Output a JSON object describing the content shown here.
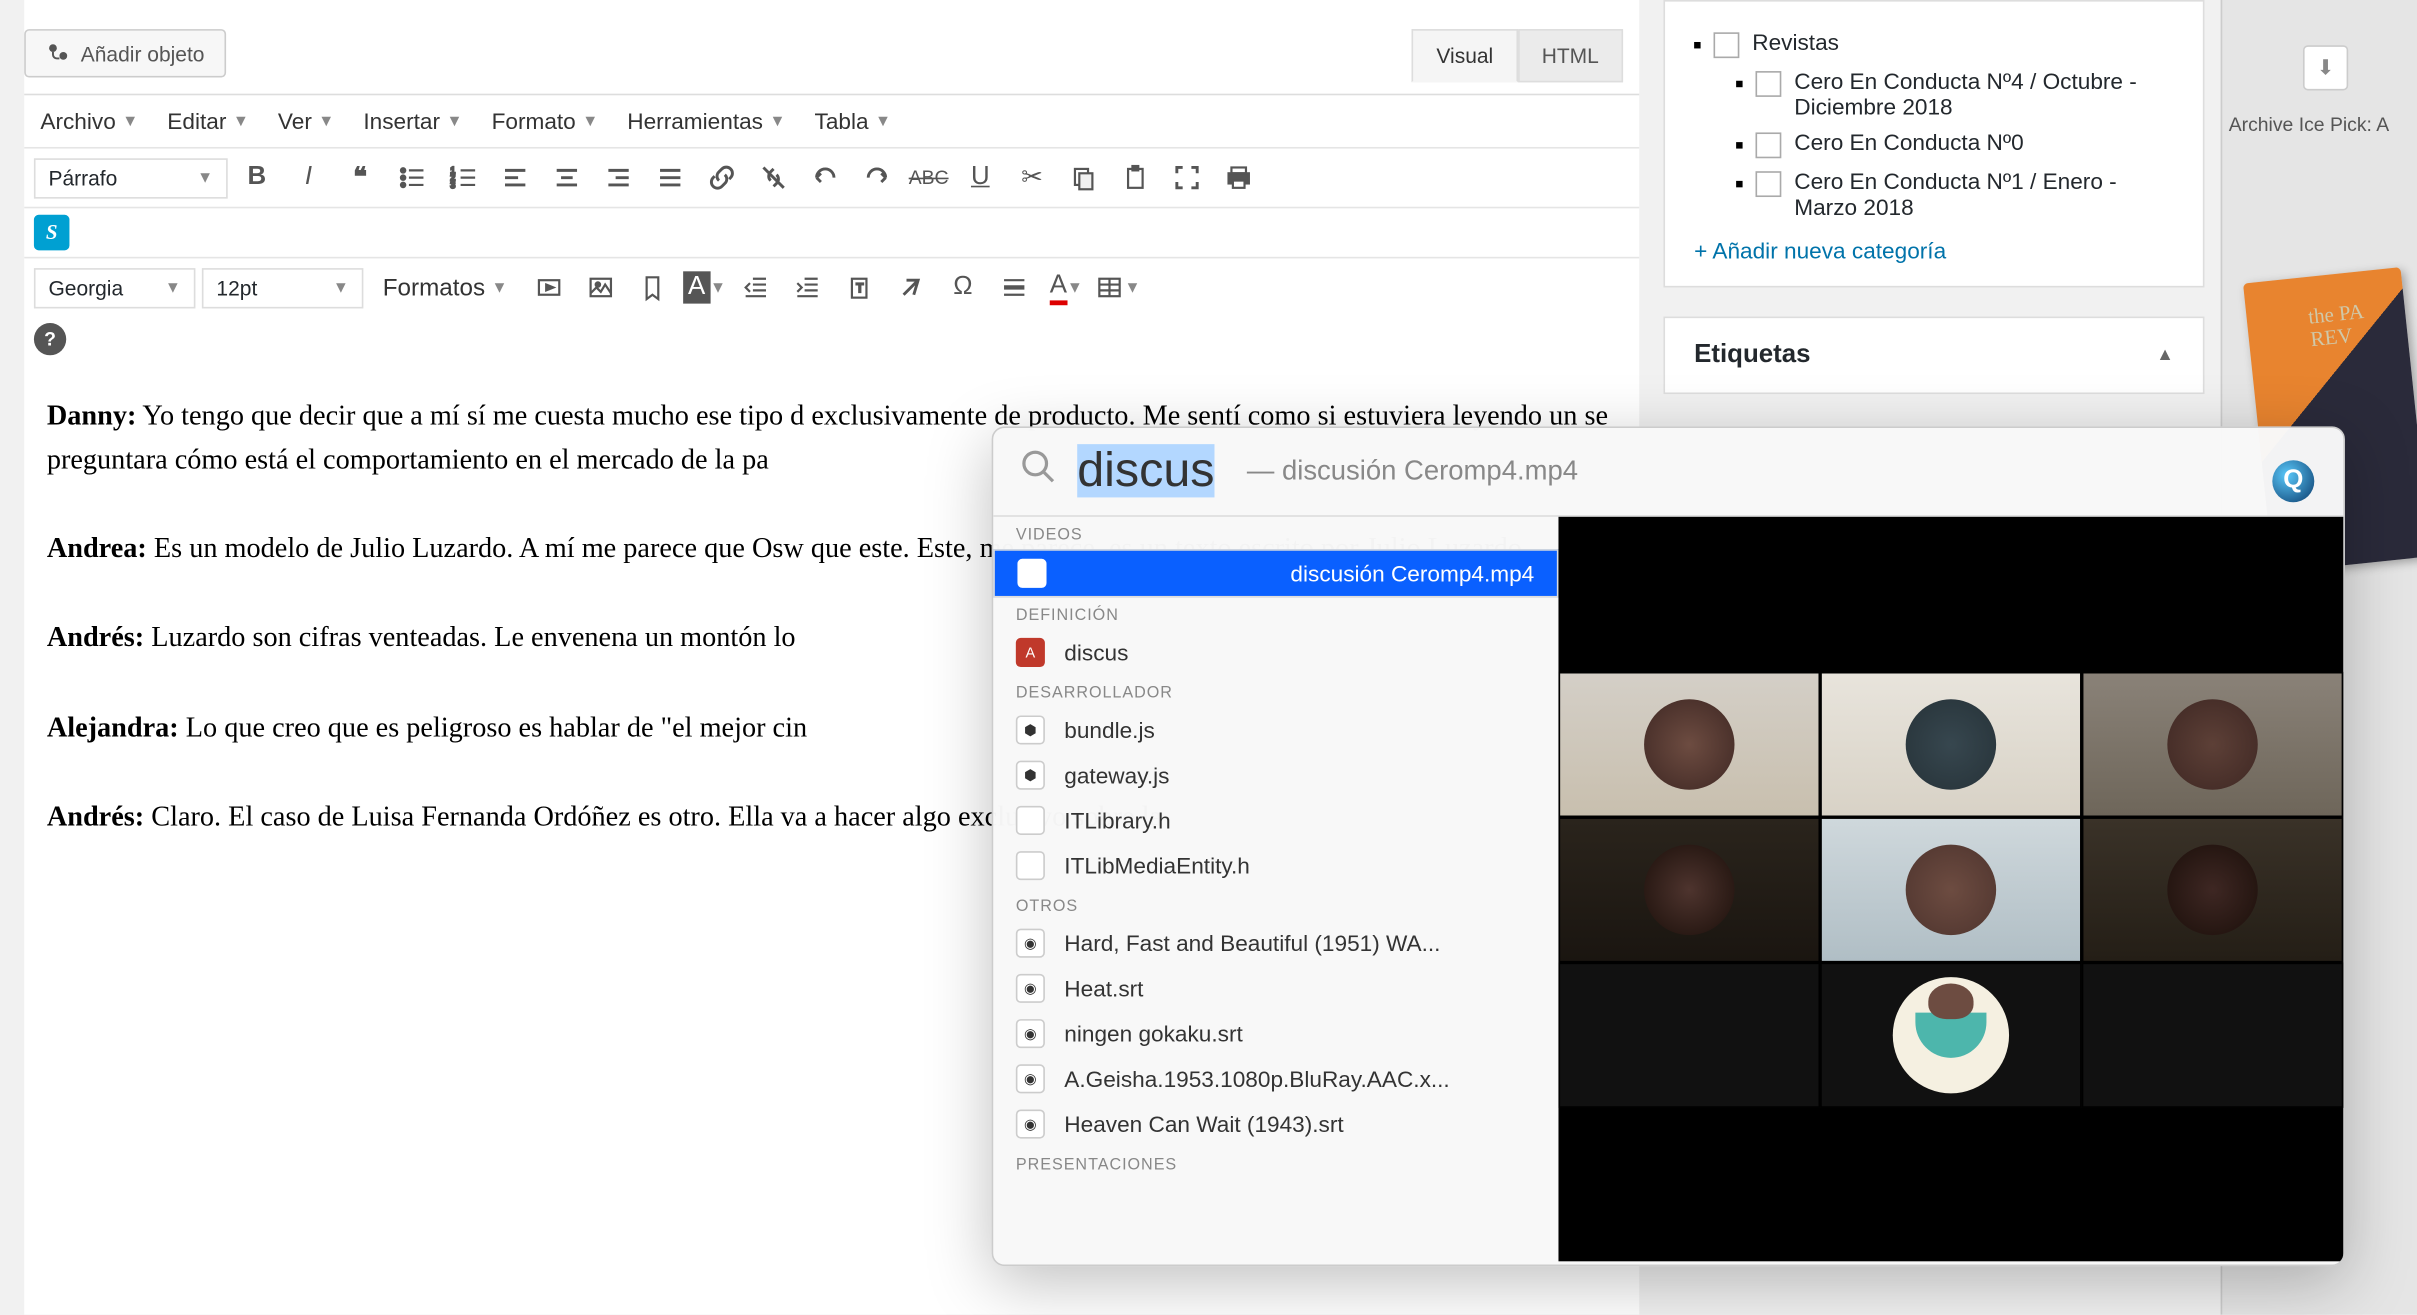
{
  "toolbar": {
    "add_media": "Añadir objeto",
    "tabs": {
      "visual": "Visual",
      "html": "HTML"
    }
  },
  "menubar": {
    "archivo": "Archivo",
    "editar": "Editar",
    "ver": "Ver",
    "insertar": "Insertar",
    "formato": "Formato",
    "herramientas": "Herramientas",
    "tabla": "Tabla"
  },
  "format_select": "Párrafo",
  "font_family": "Georgia",
  "font_size": "12pt",
  "formats_label": "Formatos",
  "content": {
    "p1_author": "Danny:",
    "p1_text": " Yo tengo que decir que a mí sí me cuesta mucho ese tipo d exclusivamente de producto. Me sentí como si estuviera leyendo un se preguntara cómo está el comportamiento en el mercado de la pa",
    "p2_author": "Andrea:",
    "p2_text": " Es un modelo de Julio Luzardo. A mí me parece que Osw que este. Este, me parece, es un texto escrito por Julio Luzardo.",
    "p3_author": "Andrés:",
    "p3_text": " Luzardo son cifras venteadas. Le envenena un montón lo",
    "p4_author": "Alejandra:",
    "p4_text": " Lo que creo que es peligroso es hablar  de \"el mejor cin",
    "p5_author": "Andrés:",
    "p5_text": " Claro. El caso de Luisa Fernanda Ordóñez es otro. Ella va a hacer algo exclusivo sobre la"
  },
  "categories": {
    "revistas": "Revistas",
    "items": [
      "Cero En Conducta Nº4 / Octubre - Diciembre 2018",
      "Cero En Conducta Nº0",
      "Cero En Conducta Nº1 / Enero - Marzo 2018"
    ],
    "add_new": "+ Añadir nueva categoría"
  },
  "tags_panel": "Etiquetas",
  "right_label": "Archive Ice Pick: A",
  "spotlight": {
    "query": "discus",
    "hint_prefix": "— ",
    "hint": "discusión Ceromp4.mp4",
    "sections": {
      "videos": "VIDEOS",
      "definicion": "DEFINICIÓN",
      "desarrollador": "DESARROLLADOR",
      "otros": "OTROS",
      "presentaciones": "PRESENTACIONES"
    },
    "items": {
      "video1": "discusión Ceromp4.mp4",
      "def1": "discus",
      "dev1": "bundle.js",
      "dev2": "gateway.js",
      "dev3": "ITLibrary.h",
      "dev4": "ITLibMediaEntity.h",
      "ot1": "Hard, Fast and Beautiful (1951) WA...",
      "ot2": "Heat.srt",
      "ot3": "ningen gokaku.srt",
      "ot4": "A.Geisha.1953.1080p.BluRay.AAC.x...",
      "ot5": "Heaven Can Wait (1943).srt"
    }
  }
}
